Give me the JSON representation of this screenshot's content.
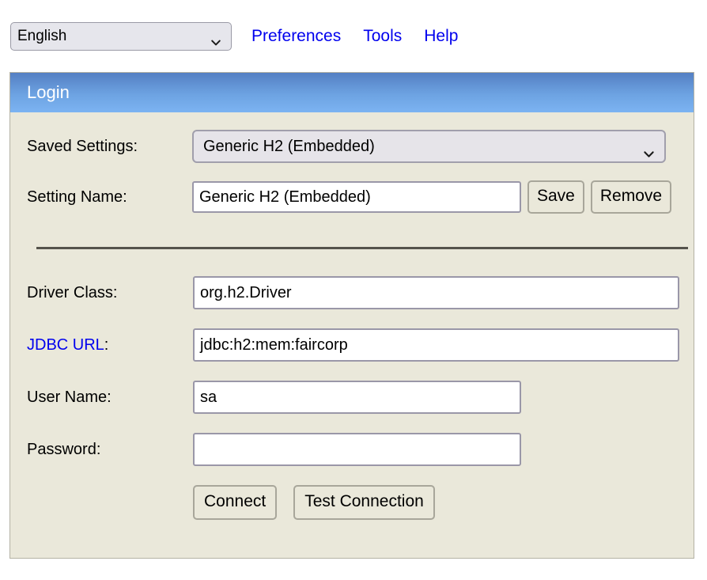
{
  "toolbar": {
    "language_select": {
      "value": "English",
      "icon": "chevron-down-icon"
    },
    "links": [
      {
        "label": "Preferences",
        "name": "preferences"
      },
      {
        "label": "Tools",
        "name": "tools"
      },
      {
        "label": "Help",
        "name": "help"
      }
    ]
  },
  "panel": {
    "title": "Login",
    "header_gradient_top": "#547fc3",
    "header_gradient_bottom": "#7cb3f2",
    "background": "#eae8da",
    "link_color": "#0000ee",
    "rows": {
      "saved_settings": {
        "label": "Saved Settings:",
        "value": "Generic H2 (Embedded)",
        "icon": "chevron-down-icon"
      },
      "setting_name": {
        "label": "Setting Name:",
        "value": "Generic H2 (Embedded)",
        "save_label": "Save",
        "remove_label": "Remove"
      },
      "driver_class": {
        "label": "Driver Class:",
        "value": "org.h2.Driver"
      },
      "jdbc_url": {
        "label": "JDBC URL",
        "colon": ":",
        "value": "jdbc:h2:mem:faircorp"
      },
      "user_name": {
        "label": "User Name:",
        "value": "sa"
      },
      "password": {
        "label": "Password:",
        "value": ""
      }
    },
    "actions": {
      "connect_label": "Connect",
      "test_connection_label": "Test Connection"
    }
  }
}
